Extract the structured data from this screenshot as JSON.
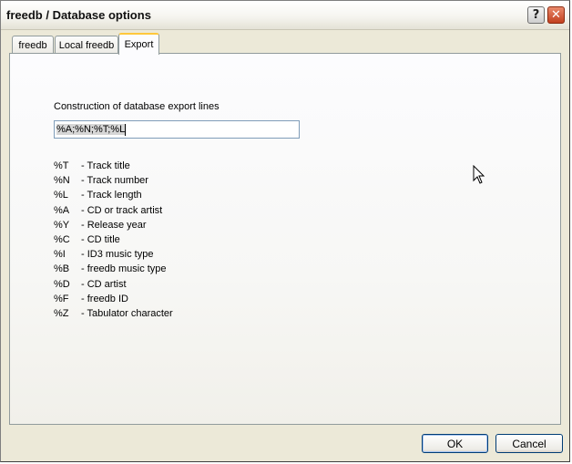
{
  "window": {
    "title": "freedb / Database options"
  },
  "tabs": [
    {
      "label": "freedb"
    },
    {
      "label": "Local freedb"
    },
    {
      "label": "Export"
    }
  ],
  "export": {
    "construction_label": "Construction of database export lines",
    "input_value": "%A;%N;%T;%L"
  },
  "legend": [
    {
      "code": "%T",
      "desc": "- Track title"
    },
    {
      "code": "%N",
      "desc": "- Track number"
    },
    {
      "code": "%L",
      "desc": "- Track length"
    },
    {
      "code": "%A",
      "desc": "- CD or track artist"
    },
    {
      "code": "%Y",
      "desc": "- Release year"
    },
    {
      "code": "%C",
      "desc": "- CD title"
    },
    {
      "code": "%I",
      "desc": "- ID3 music type"
    },
    {
      "code": "%B",
      "desc": "- freedb music type"
    },
    {
      "code": "%D",
      "desc": "- CD artist"
    },
    {
      "code": "%F",
      "desc": "- freedb ID"
    },
    {
      "code": "%Z",
      "desc": "- Tabulator character"
    }
  ],
  "buttons": {
    "ok": "OK",
    "cancel": "Cancel"
  },
  "icons": {
    "help": "help-icon",
    "close": "close-icon",
    "cursor": "mouse-pointer-icon"
  }
}
